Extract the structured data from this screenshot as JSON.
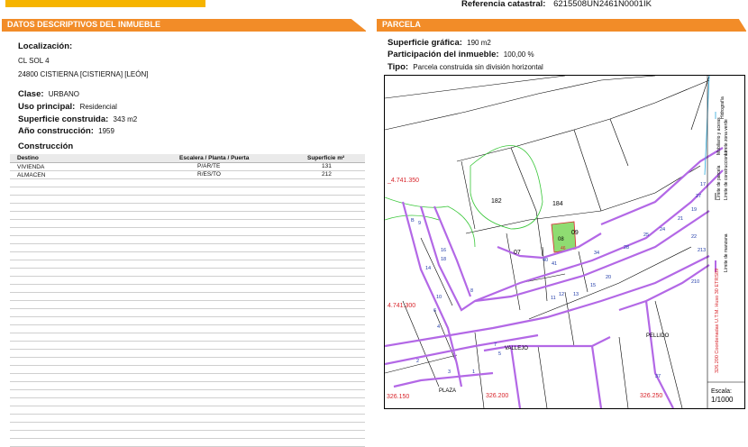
{
  "header": {
    "referencia_label": "Referencia catastral:",
    "referencia_value": "6215508UN2461N0001IK"
  },
  "left_section": {
    "tab_title": "DATOS DESCRIPTIVOS DEL INMUEBLE",
    "localizacion_label": "Localización:",
    "address_line1": "CL SOL 4",
    "address_line2": "24800 CISTIERNA [CISTIERNA] [LEÓN]",
    "clase_label": "Clase:",
    "clase_value": "URBANO",
    "uso_label": "Uso principal:",
    "uso_value": "Residencial",
    "superficie_label": "Superficie construida:",
    "superficie_value": "343 m2",
    "anio_label": "Año construcción:",
    "anio_value": "1959",
    "construccion_title": "Construcción",
    "table_headers": [
      "Destino",
      "Escalera / Planta / Puerta",
      "Superficie m²"
    ],
    "table_rows": [
      [
        "VIVIENDA",
        "P/AR/TE",
        "131"
      ],
      [
        "ALMACEN",
        "R/ES/TO",
        "212"
      ]
    ]
  },
  "right_section": {
    "tab_title": "PARCELA",
    "sup_grafica_label": "Superficie gráfica:",
    "sup_grafica_value": "190 m2",
    "participacion_label": "Participación del inmueble:",
    "participacion_value": "100,00 %",
    "tipo_label": "Tipo:",
    "tipo_value": "Parcela construida sin división horizontal"
  },
  "map": {
    "coord_labels": [
      "_4.741.350",
      "4.741.300",
      "326.150",
      "326.200",
      "326.250"
    ],
    "parcel_labels": [
      "182",
      "184",
      "07",
      "08",
      "09",
      "46"
    ],
    "street_number_labels": [
      "1",
      "3",
      "2",
      "4",
      "5",
      "6",
      "7",
      "8",
      "9",
      "10",
      "11",
      "12",
      "13",
      "14",
      "15",
      "16",
      "17",
      "18",
      "19",
      "20",
      "21",
      "22",
      "24",
      "25",
      "27",
      "28",
      "34",
      "37",
      "40",
      "41",
      "210",
      "213",
      "B"
    ],
    "street_labels": [
      "VALLEJO",
      "PELLIDO",
      "PLAZA"
    ],
    "legend_items": [
      "Límite de manzana",
      "Límite de parcela",
      "Límite de construcciones",
      "Mobiliario y aceras",
      "Límite zona verde",
      "Hidrografía"
    ],
    "legend_coord_note": "326.200 Coordenadas U.T.M. Huso 30 ETRS89",
    "scale_label": "Escala:",
    "scale_value": "1/1000",
    "colors": {
      "accent": "#f28c28",
      "manzana": "#b368e6",
      "parcela": "#000000",
      "zona_verde": "#39c739",
      "hidrografia": "#2aa7d9",
      "selected_parcel": "#8fdc72",
      "coord_text": "#d8262c",
      "street_number_text": "#1f3aa8"
    }
  }
}
